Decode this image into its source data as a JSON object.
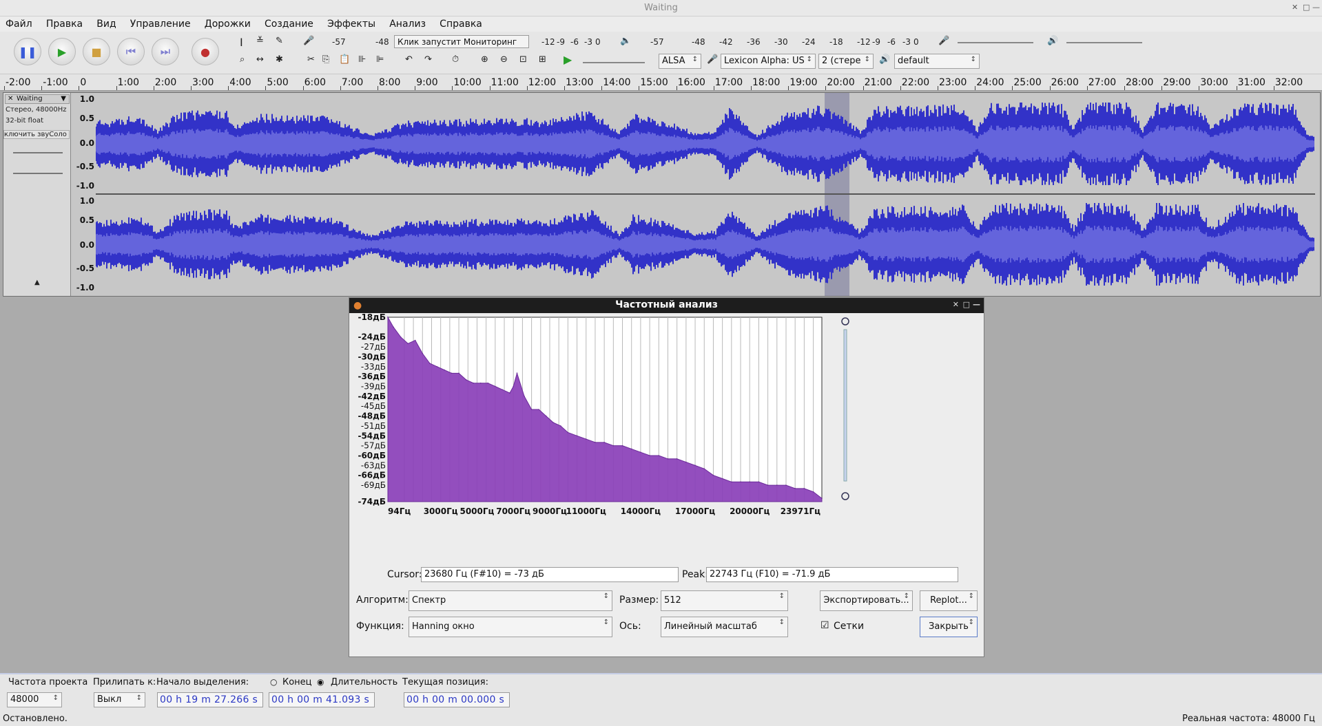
{
  "window": {
    "title": "Waiting"
  },
  "menu": [
    "Файл",
    "Правка",
    "Вид",
    "Управление",
    "Дорожки",
    "Создание",
    "Эффекты",
    "Анализ",
    "Справка"
  ],
  "toolbar": {
    "rec_meter_ticks": [
      "-57",
      "-48"
    ],
    "monitor_hint": "Клик запустит Мониторинг",
    "rec_meter_tail": [
      "-12",
      "-9",
      "-6",
      "-3",
      "0"
    ],
    "play_meter_ticks": [
      "-57",
      "-48",
      "-42",
      "-36",
      "-30",
      "-24",
      "-18",
      "-12",
      "-9",
      "-6",
      "-3",
      "0"
    ],
    "host": "ALSA",
    "rec_device": "Lexicon Alpha: US",
    "channels": "2 (стере",
    "play_device": "default"
  },
  "ruler": [
    "-2:00",
    "-1:00",
    "0",
    "1:00",
    "2:00",
    "3:00",
    "4:00",
    "5:00",
    "6:00",
    "7:00",
    "8:00",
    "9:00",
    "10:00",
    "11:00",
    "12:00",
    "13:00",
    "14:00",
    "15:00",
    "16:00",
    "17:00",
    "18:00",
    "19:00",
    "20:00",
    "21:00",
    "22:00",
    "23:00",
    "24:00",
    "25:00",
    "26:00",
    "27:00",
    "28:00",
    "29:00",
    "30:00",
    "31:00",
    "32:00"
  ],
  "track": {
    "name": "Waiting",
    "info1": "Стерео, 48000Hz",
    "info2": "32-bit float",
    "mute_solo": "ключить звуСоло",
    "scale": [
      "1.0",
      "0.5",
      "0.0",
      "-0.5",
      "-1.0"
    ],
    "colors": {
      "wave": "#3232c8",
      "rms": "#6464dc",
      "bg": "#c7c7c7",
      "selection": "#9a9aae"
    }
  },
  "analysis": {
    "title": "Частотный анализ",
    "db_labels": [
      "-18дБ",
      "-24дБ",
      "-27дБ",
      "-30дБ",
      "-33дБ",
      "-36дБ",
      "-39дБ",
      "-42дБ",
      "-45дБ",
      "-48дБ",
      "-51дБ",
      "-54дБ",
      "-57дБ",
      "-60дБ",
      "-63дБ",
      "-66дБ",
      "-69дБ",
      "-74дБ"
    ],
    "freq_labels": [
      "94Гц",
      "3000Гц",
      "5000Гц",
      "7000Гц",
      "9000Гц",
      "11000Гц",
      "14000Гц",
      "17000Гц",
      "20000Гц",
      "23971Гц"
    ],
    "cursor_label": "Cursor:",
    "cursor_value": "23680 Гц (F#10) = -73 дБ",
    "peak_label": "Peak:",
    "peak_value": "22743 Гц (F10) = -71.9 дБ",
    "algo_label": "Алгоритм:",
    "algo_value": "Спектр",
    "size_label": "Размер:",
    "size_value": "512",
    "export_button": "Экспортировать...",
    "replot_button": "Replot...",
    "func_label": "Функция:",
    "func_value": "Hanning окно",
    "axis_label": "Ось:",
    "axis_value": "Линейный масштаб",
    "grid_label": "Сетки",
    "close_button": "Закрыть",
    "colors": {
      "fill": "#8a3fb8",
      "grid": "#b9b9b9"
    }
  },
  "chart_data": {
    "type": "area",
    "xlabel": "",
    "ylabel": "",
    "xlim": [
      94,
      23971
    ],
    "ylim": [
      -74,
      -18
    ],
    "grid": true,
    "x": [
      94,
      400,
      800,
      1200,
      1600,
      2000,
      2400,
      2800,
      3200,
      3600,
      4000,
      4400,
      4800,
      5200,
      5600,
      6000,
      6400,
      6800,
      7000,
      7200,
      7600,
      8000,
      8400,
      8800,
      9200,
      9600,
      10000,
      10500,
      11000,
      11500,
      12000,
      12500,
      13000,
      13500,
      14000,
      14500,
      15000,
      15500,
      16000,
      16500,
      17000,
      17500,
      18000,
      18500,
      19000,
      19500,
      20000,
      20500,
      21000,
      21500,
      22000,
      22500,
      23000,
      23500,
      23971
    ],
    "series": [
      {
        "values": [
          -18,
          -21,
          -24,
          -26,
          -25,
          -29,
          -32,
          -33,
          -34,
          -35,
          -35,
          -37,
          -38,
          -38,
          -38,
          -39,
          -40,
          -41,
          -39,
          -35,
          -42,
          -46,
          -46,
          -48,
          -50,
          -51,
          -53,
          -54,
          -55,
          -56,
          -56,
          -57,
          -57,
          -58,
          -59,
          -60,
          -60,
          -61,
          -61,
          -62,
          -63,
          -64,
          -66,
          -67,
          -68,
          -68,
          -68,
          -68,
          -69,
          -69,
          -69,
          -70,
          -70,
          -71,
          -73
        ]
      }
    ]
  },
  "statusbar": {
    "rate_label": "Частота проекта",
    "rate_value": "48000",
    "snap_label": "Прилипать к:",
    "snap_value": "Выкл",
    "sel_start_label": "Начало выделения:",
    "end_label": "Конец",
    "len_label": "Длительность",
    "pos_label": "Текущая позиция:",
    "sel_start": "00 h 19 m 27.266 s",
    "sel_len": "00 h 00 m 41.093 s",
    "pos": "00 h 00 m 00.000 s",
    "state": "Остановлено.",
    "actual_rate": "Реальная частота: 48000 Гц"
  }
}
